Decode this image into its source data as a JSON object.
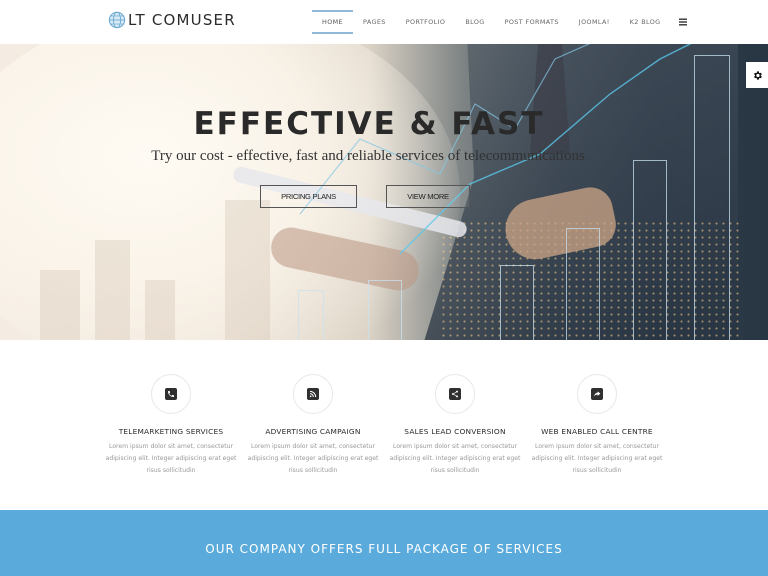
{
  "header": {
    "logo_text": "LT COMUSER",
    "nav": [
      {
        "label": "HOME",
        "active": true
      },
      {
        "label": "PAGES"
      },
      {
        "label": "PORTFOLIO"
      },
      {
        "label": "BLOG"
      },
      {
        "label": "POST FORMATS"
      },
      {
        "label": "JOOMLA!"
      },
      {
        "label": "K2 BLOG"
      }
    ],
    "menu_icon": "hamburger-menu-icon"
  },
  "hero": {
    "title": "EFFECTIVE & FAST",
    "subtitle": "Try our cost - effective, fast and reliable services of telecommunications",
    "buttons": {
      "pricing": "PRICING PLANS",
      "view_more": "VIEW MORE"
    },
    "settings_icon": "gear-icon"
  },
  "services": [
    {
      "icon": "phone-icon",
      "title": "TELEMARKETING SERVICES",
      "description": "Lorem ipsum dolor sit amet, consectetur adipiscing elit. Integer adipiscing erat eget risus sollicitudin"
    },
    {
      "icon": "rss-icon",
      "title": "ADVERTISING CAMPAIGN",
      "description": "Lorem ipsum dolor sit amet, consectetur adipiscing elit. Integer adipiscing erat eget risus sollicitudin"
    },
    {
      "icon": "share-icon",
      "title": "SALES LEAD CONVERSION",
      "description": "Lorem ipsum dolor sit amet, consectetur adipiscing elit. Integer adipiscing erat eget risus sollicitudin"
    },
    {
      "icon": "share-arrow-icon",
      "title": "WEB ENABLED CALL CENTRE",
      "description": "Lorem ipsum dolor sit amet, consectetur adipiscing elit. Integer adipiscing erat eget risus sollicitudin"
    }
  ],
  "banner": {
    "text": "OUR COMPANY OFFERS FULL PACKAGE OF SERVICES"
  },
  "colors": {
    "accent": "#5aabdb",
    "nav_active_line": "#8fb8d9",
    "text_dark": "#2a2a2a",
    "text_muted": "#999999"
  }
}
